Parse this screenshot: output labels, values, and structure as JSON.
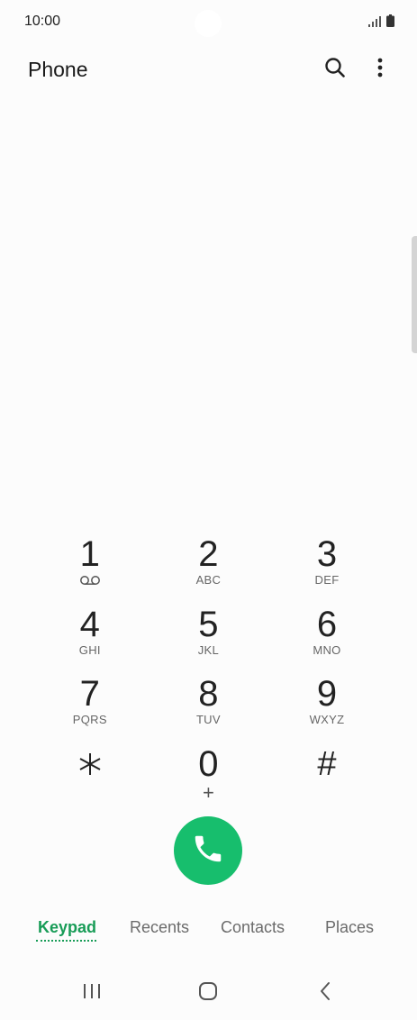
{
  "status_bar": {
    "time": "10:00"
  },
  "app_bar": {
    "title": "Phone",
    "search_icon": "search-icon",
    "more_icon": "more-vertical-icon"
  },
  "keypad": {
    "keys": [
      {
        "digit": "1",
        "letters": "",
        "sub_icon": "voicemail-icon"
      },
      {
        "digit": "2",
        "letters": "ABC"
      },
      {
        "digit": "3",
        "letters": "DEF"
      },
      {
        "digit": "4",
        "letters": "GHI"
      },
      {
        "digit": "5",
        "letters": "JKL"
      },
      {
        "digit": "6",
        "letters": "MNO"
      },
      {
        "digit": "7",
        "letters": "PQRS"
      },
      {
        "digit": "8",
        "letters": "TUV"
      },
      {
        "digit": "9",
        "letters": "WXYZ"
      },
      {
        "digit": "*",
        "letters": ""
      },
      {
        "digit": "0",
        "letters": "+"
      },
      {
        "digit": "#",
        "letters": ""
      }
    ]
  },
  "call_button": {
    "icon": "phone-call-icon",
    "color": "#17be6d"
  },
  "tabs": [
    {
      "label": "Keypad",
      "active": true
    },
    {
      "label": "Recents",
      "active": false
    },
    {
      "label": "Contacts",
      "active": false
    },
    {
      "label": "Places",
      "active": false
    }
  ],
  "nav_bar": {
    "recents_icon": "recent-apps-icon",
    "home_icon": "home-icon",
    "back_icon": "back-icon"
  },
  "colors": {
    "accent": "#189c57",
    "call_green": "#17be6d",
    "background": "#fcfcfc"
  }
}
